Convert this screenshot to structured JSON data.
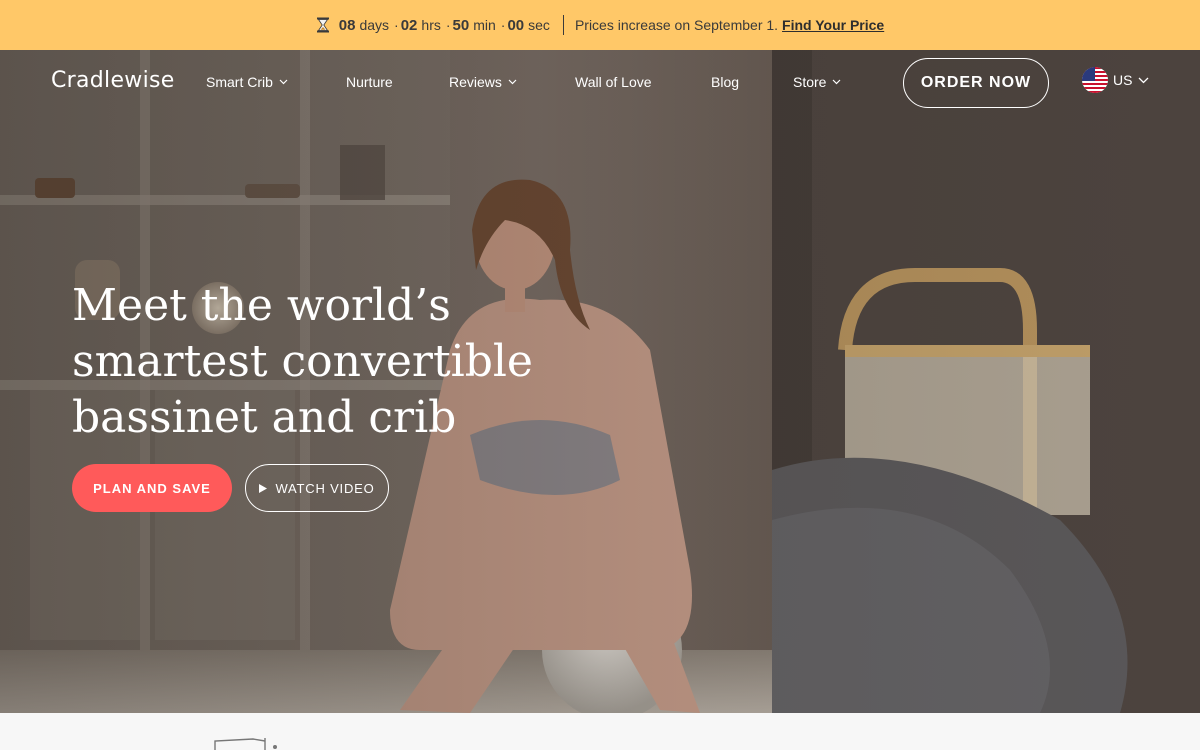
{
  "promo": {
    "countdown": [
      {
        "value": "08",
        "unit": "days"
      },
      {
        "value": "02",
        "unit": "hrs"
      },
      {
        "value": "50",
        "unit": "min"
      },
      {
        "value": "00",
        "unit": "sec"
      }
    ],
    "separator": "·",
    "message": "Prices increase on September 1.",
    "link_label": "Find Your Price",
    "background": "#ffc868"
  },
  "nav": {
    "logo": "Cradlewise",
    "items": [
      {
        "label": "Smart Crib",
        "has_dropdown": true
      },
      {
        "label": "Nurture",
        "has_dropdown": false
      },
      {
        "label": "Reviews",
        "has_dropdown": true
      },
      {
        "label": "Wall of Love",
        "has_dropdown": false
      },
      {
        "label": "Blog",
        "has_dropdown": false
      },
      {
        "label": "Store",
        "has_dropdown": true
      }
    ],
    "order_button": "ORDER NOW",
    "locale": "US",
    "locale_icon": "us-flag-icon"
  },
  "hero": {
    "headline_lines": [
      "Meet the world’s",
      "smartest convertible",
      "bassinet and crib"
    ],
    "primary_cta": "PLAN AND SAVE",
    "secondary_cta": "WATCH VIDEO",
    "secondary_cta_icon": "play-icon",
    "accent_color": "#ff5a5a"
  }
}
